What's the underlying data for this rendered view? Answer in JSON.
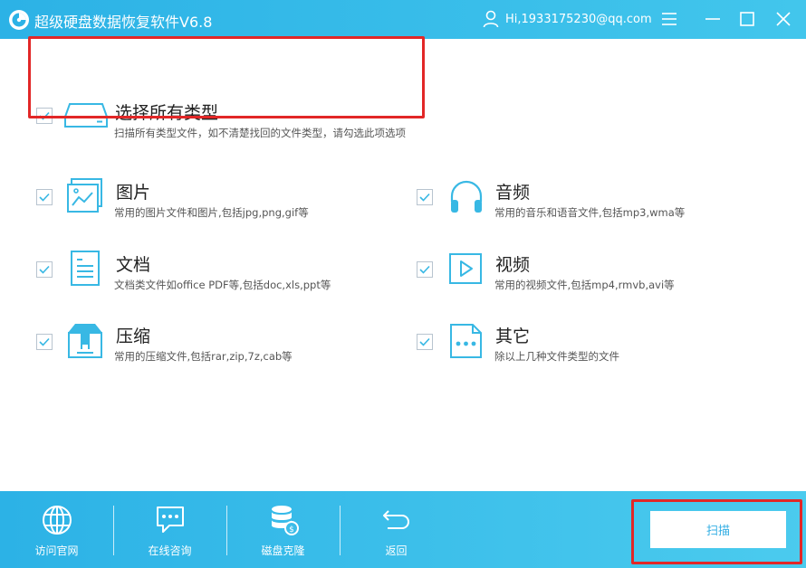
{
  "app": {
    "title": "超级硬盘数据恢复软件V6.8",
    "user_email": "Hi,1933175230@qq.com"
  },
  "colors": {
    "accent": "#2cb2e6",
    "highlight": "#e22727",
    "icon": "#38b8e4"
  },
  "types": {
    "all": {
      "title": "选择所有类型",
      "desc": "扫描所有类型文件，如不清楚找回的文件类型，请勾选此项选项",
      "icon": "hard-drive-icon",
      "checked": true
    },
    "image": {
      "title": "图片",
      "desc": "常用的图片文件和图片,包括jpg,png,gif等",
      "icon": "image-icon",
      "checked": true
    },
    "audio": {
      "title": "音频",
      "desc": "常用的音乐和语音文件,包括mp3,wma等",
      "icon": "headphones-icon",
      "checked": true
    },
    "doc": {
      "title": "文档",
      "desc": "文档类文件如office PDF等,包括doc,xls,ppt等",
      "icon": "document-icon",
      "checked": true
    },
    "video": {
      "title": "视频",
      "desc": "常用的视频文件,包括mp4,rmvb,avi等",
      "icon": "video-play-icon",
      "checked": true
    },
    "archive": {
      "title": "压缩",
      "desc": "常用的压缩文件,包括rar,zip,7z,cab等",
      "icon": "archive-icon",
      "checked": true
    },
    "other": {
      "title": "其它",
      "desc": "除以上几种文件类型的文件",
      "icon": "other-file-icon",
      "checked": true
    }
  },
  "footer": {
    "visit": "访问官网",
    "consult": "在线咨询",
    "clone": "磁盘克隆",
    "back": "返回",
    "scan": "扫描"
  }
}
